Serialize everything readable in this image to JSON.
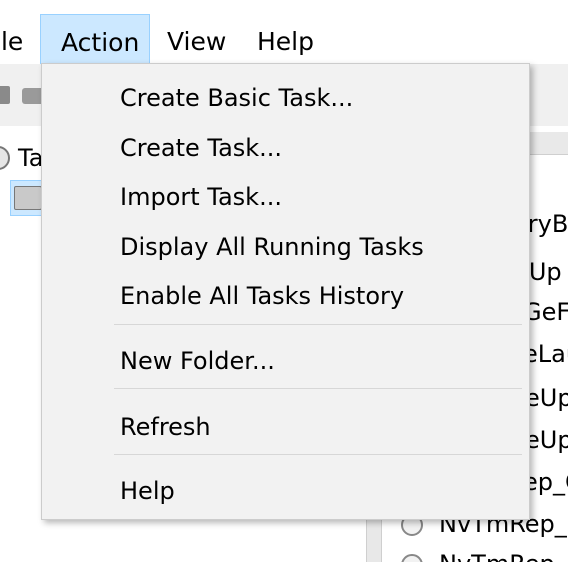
{
  "menubar": {
    "file_label": "ile",
    "action_label": "Action",
    "view_label": "View",
    "help_label": "Help"
  },
  "tree": {
    "root_label": "Ta"
  },
  "right_list": {
    "rows": [
      "eryB",
      "rUp",
      "GeF",
      "eLau",
      "eUp",
      "eUp",
      "ep_C",
      "NvTmRep_C",
      "NvTmRep_C"
    ]
  },
  "action_menu": {
    "items": [
      "Create Basic Task...",
      "Create Task...",
      "Import Task...",
      "Display All Running Tasks",
      "Enable All Tasks History",
      "New Folder...",
      "Refresh",
      "Help"
    ]
  },
  "colors": {
    "highlight": "#cce8ff",
    "highlight_border": "#99d1ff",
    "menu_background": "#f2f2f2"
  }
}
